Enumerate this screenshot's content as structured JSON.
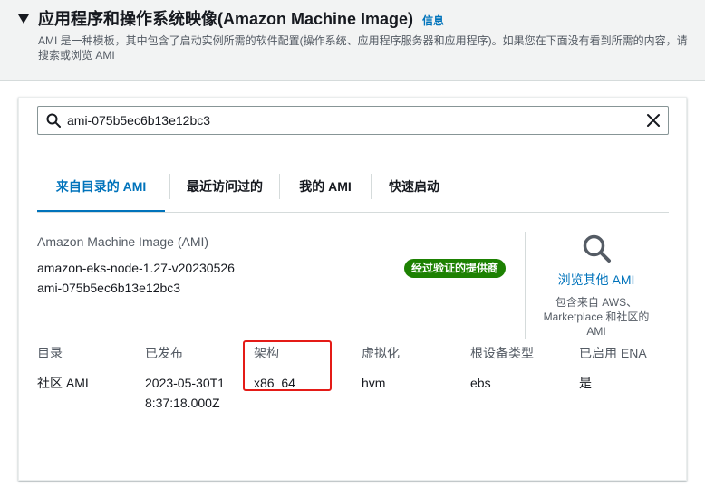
{
  "header": {
    "title": "应用程序和操作系统映像(Amazon Machine Image)",
    "info_link": "信息",
    "description": "AMI 是一种模板，其中包含了启动实例所需的软件配置(操作系统、应用程序服务器和应用程序)。如果您在下面没有看到所需的内容，请搜索或浏览 AMI"
  },
  "search": {
    "value": "ami-075b5ec6b13e12bc3"
  },
  "tabs": [
    {
      "label": "来自目录的 AMI",
      "active": true
    },
    {
      "label": "最近访问过的",
      "active": false
    },
    {
      "label": "我的 AMI",
      "active": false
    },
    {
      "label": "快速启动",
      "active": false
    }
  ],
  "ami": {
    "section_label": "Amazon Machine Image (AMI)",
    "name": "amazon-eks-node-1.27-v20230526",
    "id": "ami-075b5ec6b13e12bc3",
    "badge": "经过验证的提供商"
  },
  "browse": {
    "link": "浏览其他 AMI",
    "description": "包含来自 AWS、Marketplace 和社区的 AMI"
  },
  "details": [
    {
      "header": "目录",
      "value": "社区 AMI"
    },
    {
      "header": "已发布",
      "value": "2023-05-30T18:37:18.000Z"
    },
    {
      "header": "架构",
      "value": "x86_64"
    },
    {
      "header": "虚拟化",
      "value": "hvm"
    },
    {
      "header": "根设备类型",
      "value": "ebs"
    },
    {
      "header": "已启用 ENA",
      "value": "是"
    }
  ],
  "colors": {
    "link": "#0073bb",
    "badge": "#1d8102",
    "highlight": "#e41b17"
  }
}
